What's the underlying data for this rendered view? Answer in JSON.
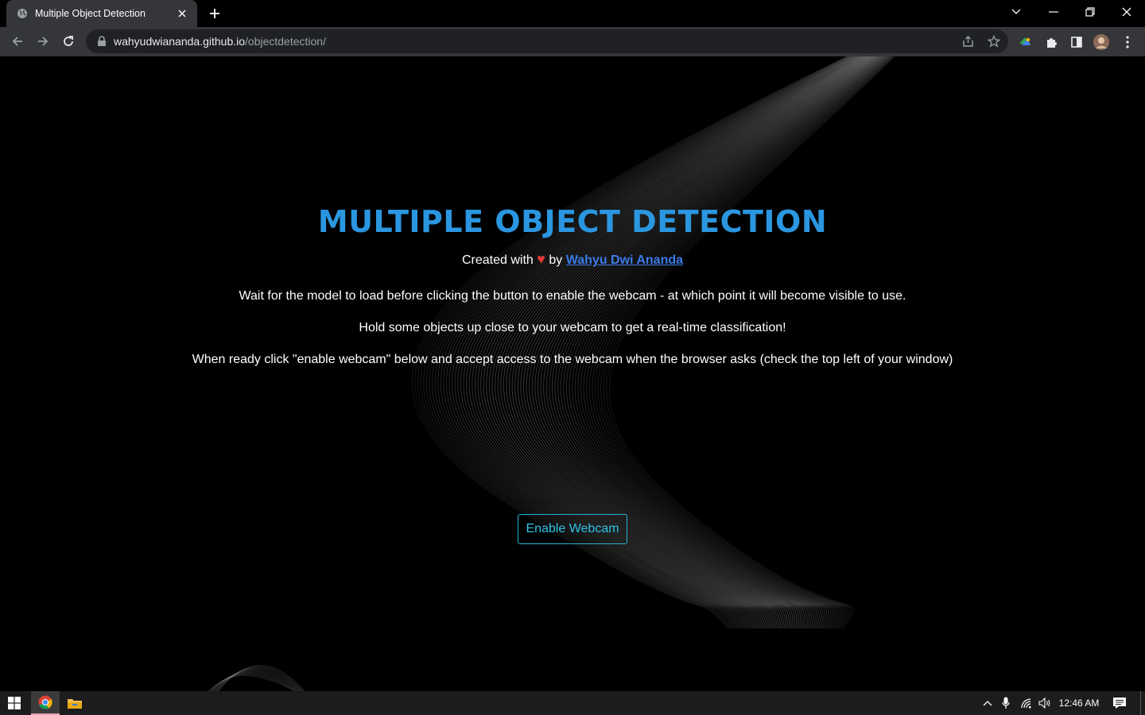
{
  "browser": {
    "tab_title": "Multiple Object Detection",
    "url_host": "wahyudwiananda.github.io",
    "url_path": "/objectdetection/"
  },
  "page": {
    "title": "MULTIPLE OBJECT DETECTION",
    "credit_prefix": "Created with",
    "credit_heart": "♥",
    "credit_by": "by",
    "credit_author": "Wahyu Dwi Ananda",
    "paragraphs": [
      "Wait for the model to load before clicking the button to enable the webcam - at which point it will become visible to use.",
      "Hold some objects up close to your webcam to get a real-time classification!",
      "When ready click \"enable webcam\" below and accept access to the webcam when the browser asks (check the top left of your window)"
    ],
    "enable_button": "Enable Webcam",
    "title_color": "#2b96e0",
    "button_color": "#27b3d6"
  },
  "taskbar": {
    "time": "12:46 AM"
  }
}
